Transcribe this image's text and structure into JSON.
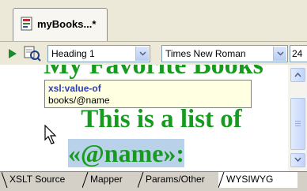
{
  "document_tab": {
    "title": "myBooks...*"
  },
  "toolbar": {
    "paragraph_style": "Heading 1",
    "font_family": "Times New Roman",
    "font_size": "24"
  },
  "canvas": {
    "heading_text": "My Favorite Books",
    "line2_text": "This is a list of",
    "line3_text": "«@name»:"
  },
  "tooltip": {
    "title": "xsl:value-of",
    "value": "books/@name"
  },
  "bottom_tabs": [
    {
      "label": "XSLT Source",
      "active": false
    },
    {
      "label": "Mapper",
      "active": false
    },
    {
      "label": "Params/Other",
      "active": false
    },
    {
      "label": "WYSIWYG",
      "active": true
    }
  ],
  "colors": {
    "heading_green": "#179b1f",
    "selection": "#b9d2ea",
    "tooltip_bg": "#ffffe1"
  }
}
